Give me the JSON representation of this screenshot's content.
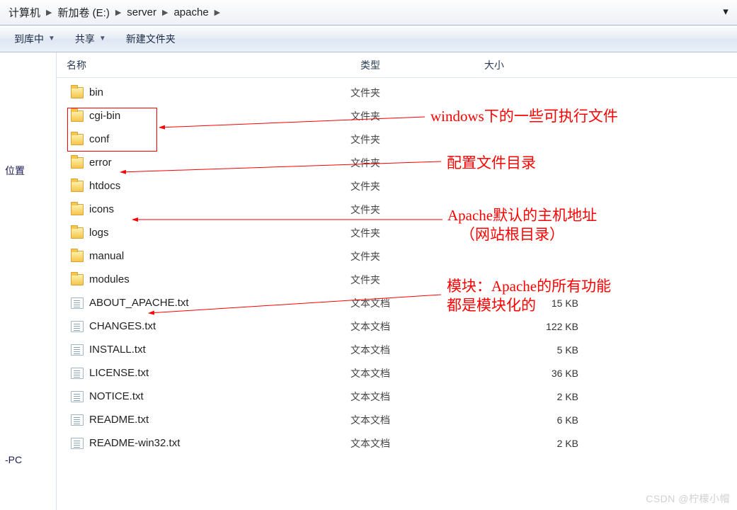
{
  "breadcrumbs": [
    {
      "label": "计算机"
    },
    {
      "label": "新加卷 (E:)"
    },
    {
      "label": "server"
    },
    {
      "label": "apache"
    }
  ],
  "toolbar": {
    "include": "到库中",
    "share": "共享",
    "new_folder": "新建文件夹"
  },
  "columns": {
    "name": "名称",
    "type": "类型",
    "size": "大小"
  },
  "type_labels": {
    "folder": "文件夹",
    "txt": "文本文档"
  },
  "nav_left": {
    "places": "位置",
    "pc": "-PC"
  },
  "files": [
    {
      "name": "bin",
      "kind": "folder",
      "size": ""
    },
    {
      "name": "cgi-bin",
      "kind": "folder",
      "size": ""
    },
    {
      "name": "conf",
      "kind": "folder",
      "size": ""
    },
    {
      "name": "error",
      "kind": "folder",
      "size": ""
    },
    {
      "name": "htdocs",
      "kind": "folder",
      "size": ""
    },
    {
      "name": "icons",
      "kind": "folder",
      "size": ""
    },
    {
      "name": "logs",
      "kind": "folder",
      "size": ""
    },
    {
      "name": "manual",
      "kind": "folder",
      "size": ""
    },
    {
      "name": "modules",
      "kind": "folder",
      "size": ""
    },
    {
      "name": "ABOUT_APACHE.txt",
      "kind": "txt",
      "size": "15 KB"
    },
    {
      "name": "CHANGES.txt",
      "kind": "txt",
      "size": "122 KB"
    },
    {
      "name": "INSTALL.txt",
      "kind": "txt",
      "size": "5 KB"
    },
    {
      "name": "LICENSE.txt",
      "kind": "txt",
      "size": "36 KB"
    },
    {
      "name": "NOTICE.txt",
      "kind": "txt",
      "size": "2 KB"
    },
    {
      "name": "README.txt",
      "kind": "txt",
      "size": "6 KB"
    },
    {
      "name": "README-win32.txt",
      "kind": "txt",
      "size": "2 KB"
    }
  ],
  "annotations": {
    "bin": "windows下的一些可执行文件",
    "conf": "配置文件目录",
    "htdocs_1": "Apache默认的主机地址",
    "htdocs_2": "（网站根目录）",
    "modules_1": "模块：Apache的所有功能",
    "modules_2": "都是模块化的"
  },
  "watermark": "CSDN @柠檬小帽"
}
